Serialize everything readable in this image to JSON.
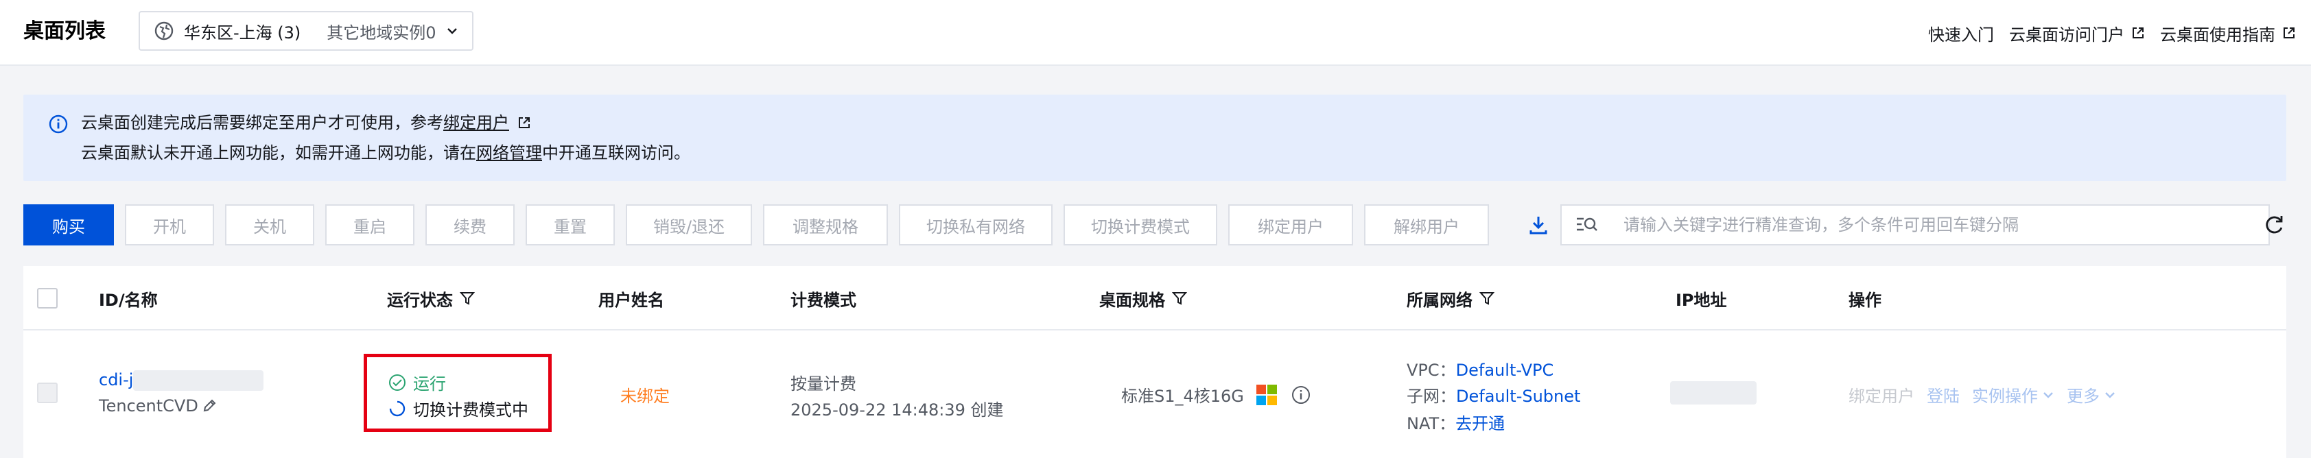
{
  "header": {
    "title": "桌面列表",
    "region_current": "华东区-上海 (3)",
    "region_other": "其它地域实例0",
    "links": [
      "快速入门",
      "云桌面访问门户",
      "云桌面使用指南"
    ]
  },
  "notice": {
    "line1_prefix": "云桌面创建完成后需要绑定至用户才可使用，参考",
    "line1_link": "绑定用户",
    "line2_prefix": "云桌面默认未开通上网功能，如需开通上网功能，请在",
    "line2_link": "网络管理",
    "line2_suffix": "中开通互联网访问。"
  },
  "toolbar": {
    "buttons": [
      "购买",
      "开机",
      "关机",
      "重启",
      "续费",
      "重置",
      "销毁/退还",
      "调整规格",
      "切换私有网络",
      "切换计费模式",
      "绑定用户",
      "解绑用户"
    ],
    "search_placeholder": "请输入关键字进行精准查询，多个条件可用回车键分隔"
  },
  "table": {
    "columns": [
      "ID/名称",
      "运行状态",
      "用户姓名",
      "计费模式",
      "桌面规格",
      "所属网络",
      "IP地址",
      "操作"
    ],
    "rows": [
      {
        "id": "cdi-j",
        "name": "TencentCVD",
        "status": "运行",
        "status_sub": "切换计费模式中",
        "user": "未绑定",
        "billing": "按量计费",
        "created": "2025-09-22 14:48:39 创建",
        "spec": "标准S1_4核16G",
        "vpc_label": "VPC：",
        "vpc": "Default-VPC",
        "subnet_label": "子网：",
        "subnet": "Default-Subnet",
        "nat_label": "NAT：",
        "nat": "去开通",
        "actions": [
          "绑定用户",
          "登陆",
          "实例操作",
          "更多"
        ]
      }
    ]
  },
  "colors": {
    "primary": "#0052d9",
    "notice_bg": "#e5edfd",
    "running": "#2ba471",
    "unbound": "#ff7e21",
    "highlight": "#e50012"
  }
}
